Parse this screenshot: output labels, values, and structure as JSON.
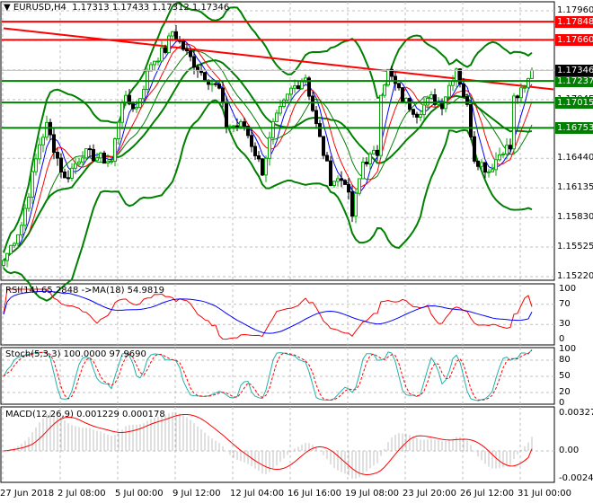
{
  "header": {
    "symbol": "EURUSD,H4",
    "open": "1.17313",
    "high": "1.17433",
    "low": "1.17312",
    "close": "1.17346"
  },
  "colors": {
    "bull": "#00aa00",
    "bear": "#000000",
    "resistance": "#ff0000",
    "support": "#008000",
    "rsi": "#ff0000",
    "rsi_ma": "#0000ff",
    "stoch_main": "#20b2aa",
    "stoch_signal": "#ff0000",
    "macd_hist": "#c0c0c0",
    "macd_signal": "#ff0000",
    "bollinger": "#008000",
    "grid": "#c0c0c0"
  },
  "chart_data": [
    {
      "type": "candlestick",
      "title": "EURUSD,H4",
      "ylim": [
        1.1522,
        1.1796
      ],
      "yticks": [
        "1.17960",
        "1.17655",
        "1.17350",
        "1.17045",
        "1.16440",
        "1.16135",
        "1.15830",
        "1.15525",
        "1.15220"
      ],
      "xticks": [
        "27 Jun 2018",
        "2 Jul 08:00",
        "5 Jul 00:00",
        "9 Jul 12:00",
        "12 Jul 04:00",
        "16 Jul 16:00",
        "19 Jul 08:00",
        "23 Jul 20:00",
        "26 Jul 12:00",
        "31 Jul 00:00"
      ],
      "close_path": [
        [
          0,
          1.15386
        ],
        [
          5,
          1.15756
        ],
        [
          10,
          1.1659
        ],
        [
          12,
          1.16775
        ],
        [
          17,
          1.16219
        ],
        [
          22,
          1.16497
        ],
        [
          30,
          1.16404
        ],
        [
          33,
          1.17053
        ],
        [
          37,
          1.1696
        ],
        [
          41,
          1.17423
        ],
        [
          45,
          1.17562
        ],
        [
          47,
          1.17747
        ],
        [
          51,
          1.17516
        ],
        [
          55,
          1.1733
        ],
        [
          60,
          1.17145
        ],
        [
          62,
          1.16775
        ],
        [
          67,
          1.16775
        ],
        [
          72,
          1.16312
        ],
        [
          75,
          1.16775
        ],
        [
          80,
          1.17145
        ],
        [
          84,
          1.17284
        ],
        [
          87,
          1.16775
        ],
        [
          91,
          1.16219
        ],
        [
          95,
          1.16219
        ],
        [
          97,
          1.15849
        ],
        [
          100,
          1.16404
        ],
        [
          104,
          1.16497
        ],
        [
          105,
          1.17145
        ],
        [
          107,
          1.1733
        ],
        [
          111,
          1.17053
        ],
        [
          115,
          1.16914
        ],
        [
          119,
          1.17053
        ],
        [
          122,
          1.17006
        ],
        [
          126,
          1.17377
        ],
        [
          129,
          1.1696
        ],
        [
          131,
          1.16451
        ],
        [
          135,
          1.16312
        ],
        [
          139,
          1.16543
        ],
        [
          141,
          1.16543
        ],
        [
          142,
          1.17053
        ],
        [
          145,
          1.17145
        ],
        [
          147,
          1.17346
        ]
      ],
      "levels": [
        {
          "price": 1.17848,
          "label": "1.17848",
          "kind": "resistance"
        },
        {
          "price": 1.1766,
          "label": "1.17660",
          "kind": "resistance"
        },
        {
          "price": 1.17237,
          "label": "1.17237",
          "kind": "support"
        },
        {
          "price": 1.17015,
          "label": "1.17015",
          "kind": "support"
        },
        {
          "price": 1.16753,
          "label": "1.16753",
          "kind": "support"
        }
      ],
      "current_price": "1.17346",
      "trendline": {
        "from": [
          0,
          1.1778
        ],
        "to": [
          153,
          1.1715
        ]
      }
    },
    {
      "type": "line",
      "title": "RSI(14) 65.2848  ->MA(18) 54.9819",
      "ylim": [
        0,
        100
      ],
      "yticks": [
        "100",
        "70",
        "30",
        "0"
      ],
      "value": 65.2848,
      "ma": 54.9819
    },
    {
      "type": "line",
      "title": "Stoch(5,3,3) 100.0000 97.9690",
      "ylim": [
        0,
        100
      ],
      "yticks": [
        "100",
        "80",
        "50",
        "20",
        "0"
      ],
      "main": 100.0,
      "signal": 97.969
    },
    {
      "type": "bar",
      "title": "MACD(12,26,9) 0.001229 0.000178",
      "ylim": [
        -0.002436,
        0.003273
      ],
      "yticks": [
        "0.003273",
        "0.00",
        "-0.002436"
      ],
      "macd": 0.001229,
      "signal": 0.000178
    }
  ]
}
